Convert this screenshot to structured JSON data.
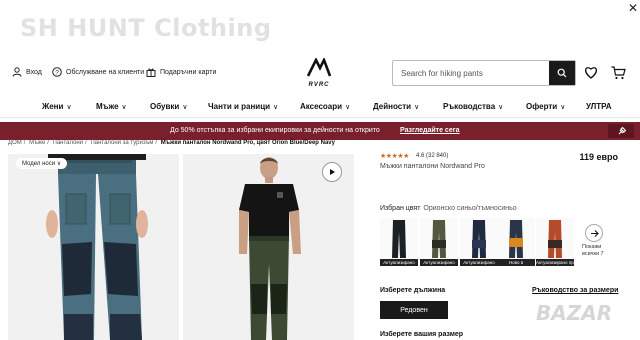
{
  "watermark_top": "SH HUNT Clothing",
  "watermark_bottom": "BAZAR",
  "header": {
    "login": "Вход",
    "service": "Обслужване на клиенти",
    "gift": "Подаръчни карти",
    "logo_text": "REVOLUTION RACE",
    "search_placeholder": "Search for hiking pants"
  },
  "nav": {
    "items": [
      {
        "label": "Жени",
        "chevron": true
      },
      {
        "label": "Мъже",
        "chevron": true
      },
      {
        "label": "Обувки",
        "chevron": true
      },
      {
        "label": "Чанти и раници",
        "chevron": true
      },
      {
        "label": "Аксесоари",
        "chevron": true
      },
      {
        "label": "Дейности",
        "chevron": true
      },
      {
        "label": "Ръководства",
        "chevron": true
      },
      {
        "label": "Оферти",
        "chevron": true
      },
      {
        "label": "УЛТРА",
        "chevron": false
      }
    ]
  },
  "promo": {
    "text": "До 50% отстъпка за избрани екипировки за дейности на открито",
    "link": "Разгледайте сега"
  },
  "breadcrumb": {
    "items": [
      "ДОМ",
      "Мъже",
      "Панталони",
      "Панталони за туризъм",
      "Мъжки панталон Nordwand Pro, цвят Orion Blue/Deep Navy"
    ]
  },
  "gallery": {
    "model_tag": "Модел носи"
  },
  "product": {
    "stars": "★★★★★",
    "rating": "4.6 (32 840)",
    "price": "119 евро",
    "subtitle": "Мъжки панталони Nordwand Pro",
    "color_label": "Избран цвят",
    "color_value": "Орионско синьо/тъмносиньо",
    "swatches": [
      {
        "badge": "Актуализирано",
        "color": "#1c1f24",
        "accent": "#2d3138"
      },
      {
        "badge": "Актуализирано",
        "color": "#55583f",
        "accent": "#2b2d22"
      },
      {
        "badge": "Актуализирано",
        "color": "#1f2a40",
        "accent": "#283654"
      },
      {
        "badge": "Ново в",
        "color": "#2a3548",
        "accent": "#d88a22"
      },
      {
        "badge": "Актуализирано през лятото",
        "color": "#b64b2a",
        "accent": "#3a2a24"
      }
    ],
    "show_all": "Покажи всички 7",
    "length_label": "Изберете дължина",
    "size_guide": "Ръководство за размери",
    "length_option": "Редовен",
    "size_label": "Изберете вашия размер"
  },
  "colors": {
    "promo_bg": "#7a1f2c",
    "star": "#d06a1e"
  }
}
